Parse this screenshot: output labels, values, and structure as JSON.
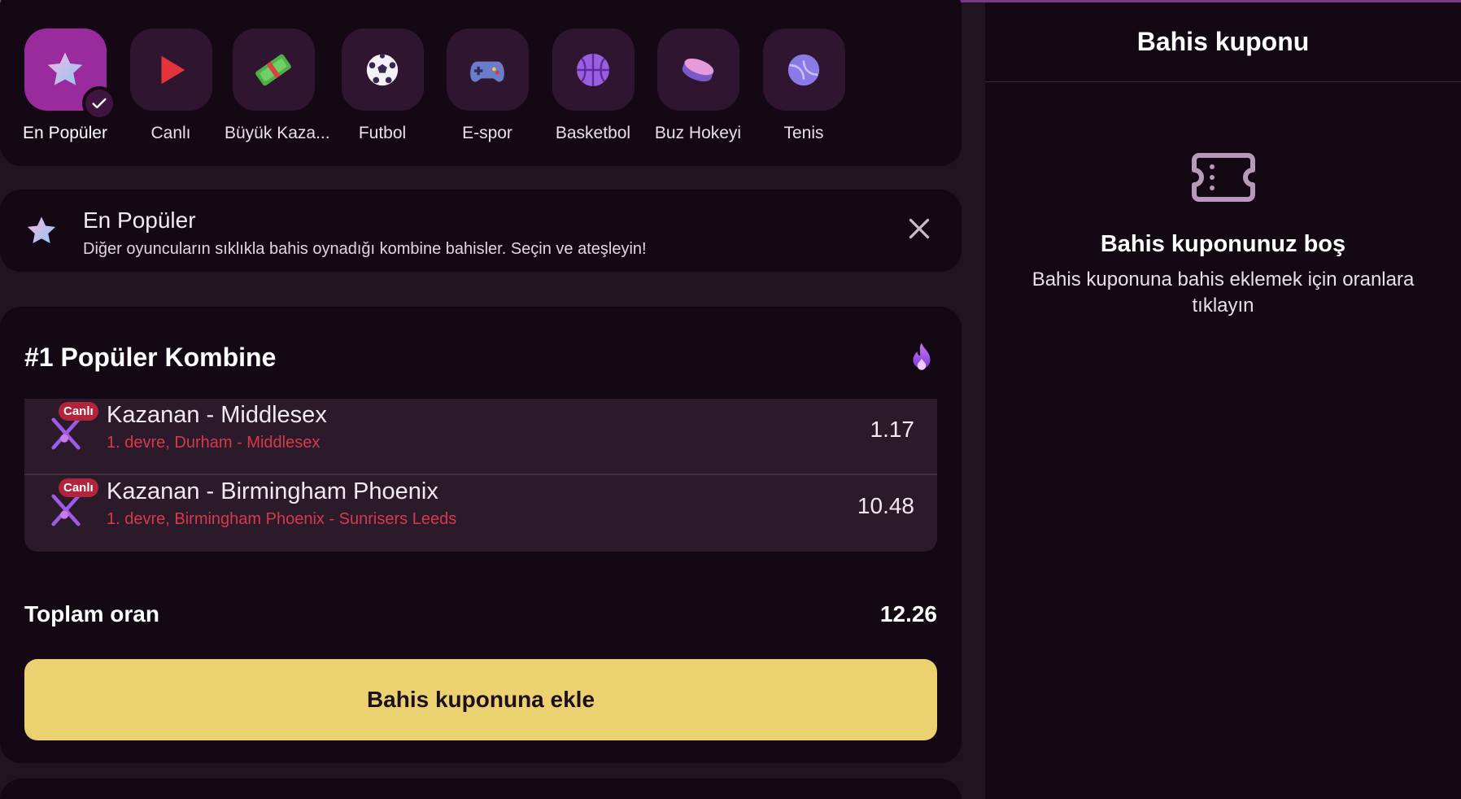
{
  "categories": [
    {
      "label": "En Popüler",
      "icon": "star-icon",
      "active": true
    },
    {
      "label": "Canlı",
      "icon": "play-icon",
      "active": false
    },
    {
      "label": "Büyük Kaza...",
      "icon": "money-icon",
      "active": false
    },
    {
      "label": "Futbol",
      "icon": "soccer-ball-icon",
      "active": false
    },
    {
      "label": "E-spor",
      "icon": "gamepad-icon",
      "active": false
    },
    {
      "label": "Basketbol",
      "icon": "basketball-icon",
      "active": false
    },
    {
      "label": "Buz Hokeyi",
      "icon": "hockey-puck-icon",
      "active": false
    },
    {
      "label": "Tenis",
      "icon": "tennis-ball-icon",
      "active": false
    }
  ],
  "info": {
    "title": "En Popüler",
    "description": "Diğer oyuncuların sıklıkla bahis oynadığı kombine bahisler. Seçin ve ateşleyin!"
  },
  "combo": {
    "title": "#1 Popüler Kombine",
    "picks": [
      {
        "badge": "Canlı",
        "market": "Kazanan - Middlesex",
        "event": "1. devre, Durham - Middlesex",
        "odds": "1.17"
      },
      {
        "badge": "Canlı",
        "market": "Kazanan - Birmingham Phoenix",
        "event": "1. devre, Birmingham Phoenix - Sunrisers Leeds",
        "odds": "10.48"
      }
    ],
    "total_label": "Toplam oran",
    "total_value": "12.26",
    "add_button": "Bahis kuponuna ekle"
  },
  "slip": {
    "title": "Bahis kuponu",
    "empty_title": "Bahis kuponunuz boş",
    "empty_desc": "Bahis kuponuna bahis eklemek için oranlara tıklayın"
  },
  "colors": {
    "background": "#211421",
    "panel": "#150815",
    "active_tile": "#9a2b9c",
    "accent_button": "#ecd170",
    "live_red": "#b2243a",
    "event_red": "#d83a4c"
  }
}
